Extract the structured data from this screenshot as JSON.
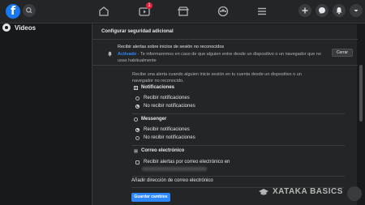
{
  "topbar": {
    "logo": "f",
    "notification_badge": "1",
    "icons": [
      "search-icon",
      "home-icon",
      "watch-icon",
      "marketplace-icon",
      "groups-icon",
      "menu-icon",
      "plus-icon",
      "messenger-icon",
      "bell-icon",
      "chevron-down-icon"
    ]
  },
  "sidebar": {
    "videos_label": "Videos"
  },
  "panel": {
    "title": "Configurar seguridad adicional",
    "alert_title": "Recibir alertas sobre inicios de sesión no reconocidos",
    "alert_status": "Activado",
    "alert_desc": " · Te informaremos en caso de que alguien entre desde un dispositivo o un navegador que no usas habitualmente",
    "close_label": "Cerrar",
    "info_text": "Recibe una alerta cuando alguien inicie sesión en tu cuenta desde un dispositivo o un navegador no reconocido.",
    "notifications": {
      "heading": "Notificaciones",
      "options": [
        "Recibir notificaciones",
        "No recibir notificaciones"
      ],
      "selected": 1
    },
    "messenger": {
      "heading": "Messenger",
      "options": [
        "Recibir notificaciones",
        "No recibir notificaciones"
      ],
      "selected": 0
    },
    "email": {
      "heading": "Correo electrónico",
      "checkbox_label": "Recibir alertas por correo electrónico en",
      "add_email": "Añadir dirección de correo electrónico"
    },
    "save_label": "Guardar cambios"
  },
  "watermark": "XATAKA BASICS",
  "colors": {
    "accent": "#2d88ff",
    "badge": "#e41e3f",
    "surface": "#242526",
    "background": "#18191a"
  }
}
